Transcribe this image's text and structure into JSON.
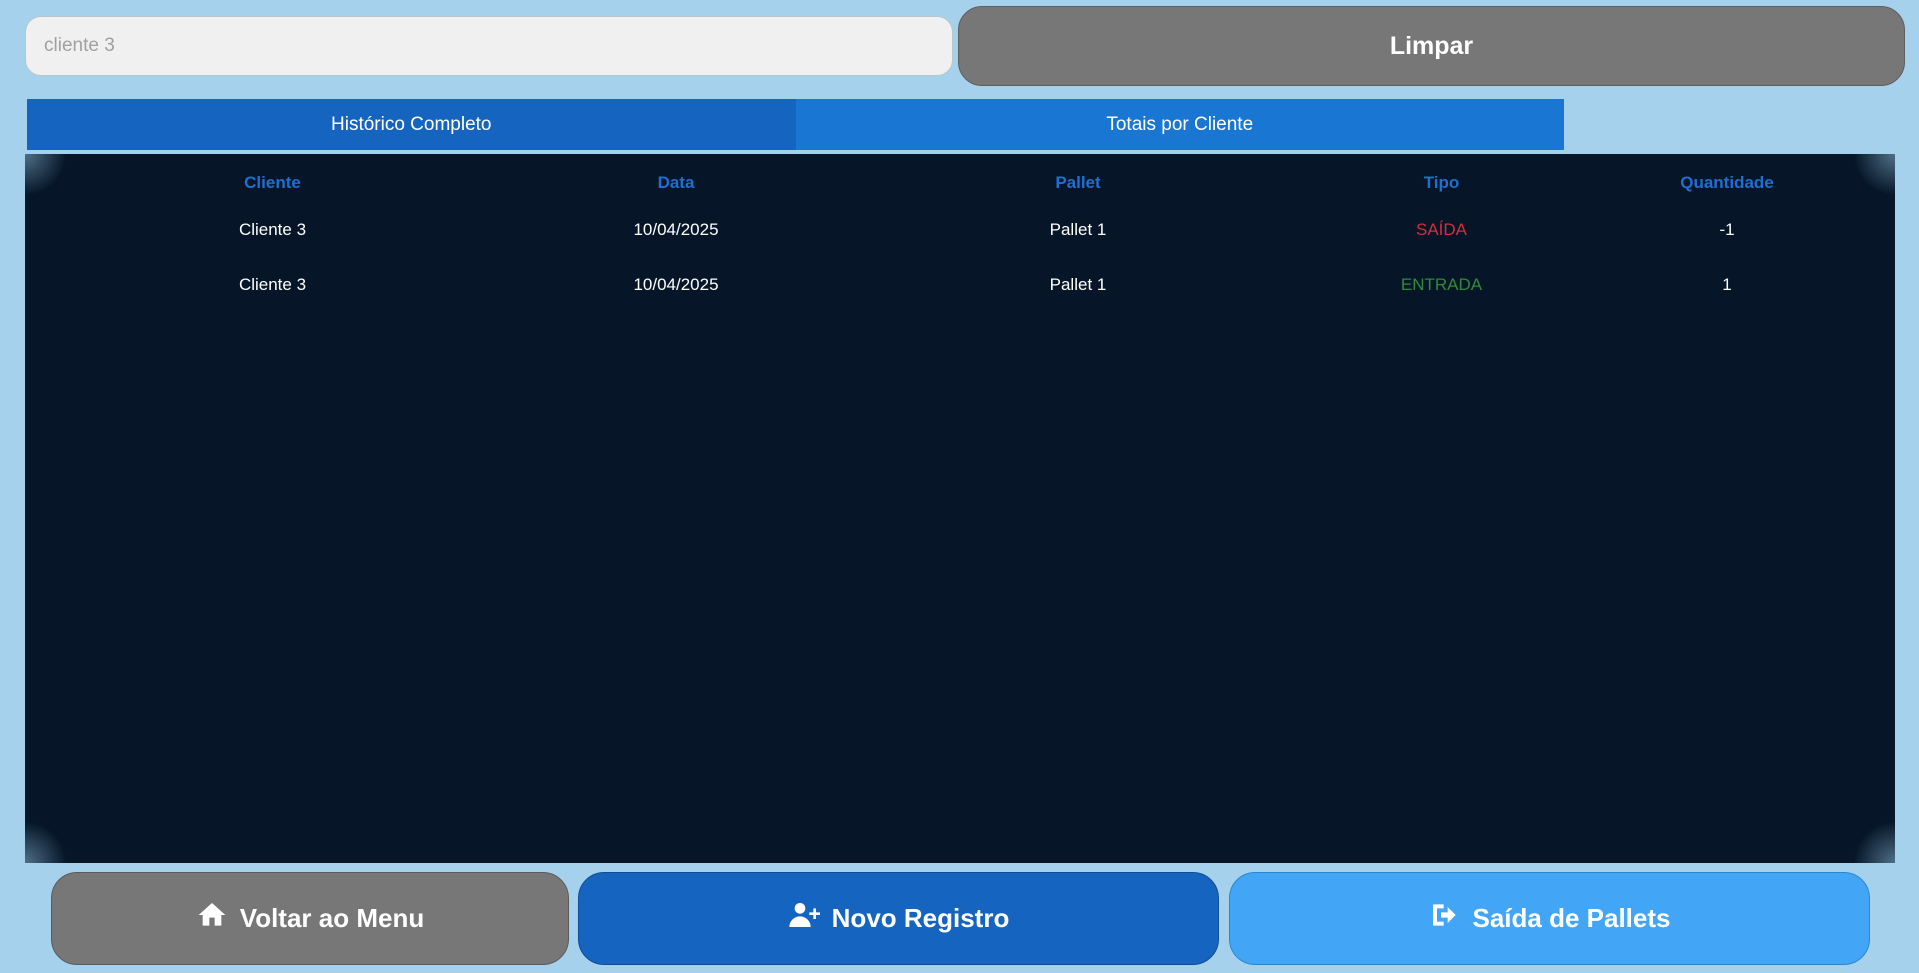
{
  "search": {
    "placeholder": "cliente 3",
    "value": ""
  },
  "clear_button": {
    "label": "Limpar"
  },
  "tabs": [
    {
      "label": "Histórico Completo"
    },
    {
      "label": "Totais por Cliente"
    }
  ],
  "table": {
    "columns": [
      "Cliente",
      "Data",
      "Pallet",
      "Tipo",
      "Quantidade"
    ],
    "rows": [
      {
        "cliente": "Cliente 3",
        "data": "10/04/2025",
        "pallet": "Pallet 1",
        "tipo": "SAÍDA",
        "quantidade": "-1"
      },
      {
        "cliente": "Cliente 3",
        "data": "10/04/2025",
        "pallet": "Pallet 1",
        "tipo": "ENTRADA",
        "quantidade": "1"
      }
    ]
  },
  "footer": {
    "menu_button": {
      "label": "Voltar ao Menu",
      "icon": "home-icon"
    },
    "novo_button": {
      "label": "Novo Registro",
      "icon": "user-plus-icon"
    },
    "saida_button": {
      "label": "Saída de Pallets",
      "icon": "sign-out-icon"
    }
  },
  "colors": {
    "background": "#a6d1ec",
    "panel": "#061628",
    "header_text": "#1e6fd0",
    "saida": "#d0303b",
    "entrada": "#2f8a3b"
  }
}
